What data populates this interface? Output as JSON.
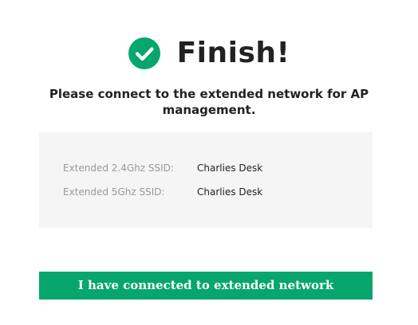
{
  "header": {
    "title": "Finish!",
    "icon": "check-circle-icon",
    "icon_color": "#06a66c"
  },
  "message": "Please connect to the extended network for AP management.",
  "ssid_info": [
    {
      "label": "Extended 2.4Ghz SSID:",
      "value": "Charlies Desk"
    },
    {
      "label": "Extended 5Ghz SSID:",
      "value": "Charlies Desk"
    }
  ],
  "actions": {
    "confirm_label": "I have connected to extended network",
    "button_color": "#06a66c"
  }
}
